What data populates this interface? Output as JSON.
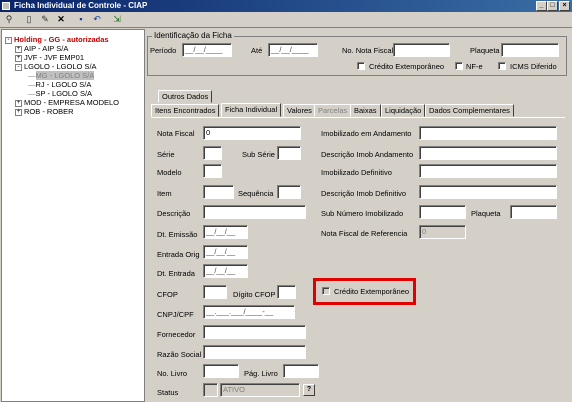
{
  "window": {
    "title": "Ficha Individual de Controle - CIAP",
    "min": "_",
    "max": "□",
    "close": "×"
  },
  "toolbar": {
    "icons": [
      "binoculars-icon",
      "new-doc-icon",
      "edit-icon",
      "delete-icon",
      "save-icon",
      "undo-icon",
      "exit-icon"
    ]
  },
  "tree": {
    "root": "Holding - GG - autorizadas",
    "items": [
      {
        "label": "AIP - AIP S/A",
        "pm": "+"
      },
      {
        "label": "JVF - JVF EMP01",
        "pm": "+"
      },
      {
        "label": "LGOLO - LGOLO S/A",
        "pm": "-"
      },
      {
        "label": "MG - LGOLO S/A",
        "sel": true
      },
      {
        "label": "RJ - LGOLO S/A"
      },
      {
        "label": "SP - LGOLO S/A"
      },
      {
        "label": "MOD - EMPRESA MODELO",
        "pm": "+"
      },
      {
        "label": "ROB - ROBER",
        "pm": "+"
      }
    ]
  },
  "ident": {
    "legend": "Identificação da Ficha",
    "periodo_label": "Período",
    "periodo_value": "__/__/____",
    "ate_label": "Até",
    "ate_value": "__/__/____",
    "nota_fiscal_label": "No. Nota Fiscal",
    "plaqueta_label": "Plaqueta",
    "cred_extemp": "Crédito Extemporâneo",
    "nfe": "NF-e",
    "icms_dif": "ICMS Diferido"
  },
  "tabs": {
    "outros": "Outros Dados",
    "list": [
      "Itens Encontrados",
      "Ficha Individual",
      "Valores",
      "Parcelas",
      "Baixas",
      "Liquidação",
      "Dados Complementares"
    ]
  },
  "form": {
    "nota_fiscal": "Nota Fiscal",
    "nota_fiscal_value": "0",
    "serie": "Série",
    "sub_serie": "Sub Série",
    "modelo": "Modelo",
    "item": "Item",
    "sequencia": "Sequência",
    "descricao": "Descrição",
    "dt_emissao": "Dt. Emissão",
    "dt_emissao_value": "__/__/__",
    "entrada_orig": "Entrada Orig",
    "entrada_orig_value": "__/__/__",
    "dt_entrada": "Dt. Entrada",
    "dt_entrada_value": "__/__/__",
    "cfop": "CFOP",
    "digito_cfop": "Dígito CFOP",
    "cnpj": "CNPJ/CPF",
    "cnpj_value": "__.___.___/____-__",
    "fornecedor": "Fornecedor",
    "razao_social": "Razão Social",
    "no_livro": "No. Livro",
    "pag_livro": "Pág. Livro",
    "status": "Status",
    "status_value": "ATIVO",
    "imob_andamento": "Imobilizado em Andamento",
    "desc_imob_andamento": "Descrição Imob Andamento",
    "imob_definitivo": "Imobilizado Definitivo",
    "desc_imob_definitivo": "Descrição Imob Definitivo",
    "sub_numero": "Sub Número Imobilizado",
    "plaqueta": "Plaqueta",
    "nf_referencia": "Nota Fiscal de Referencia",
    "nf_referencia_value": "0",
    "cred_extemp": "Crédito Extemporâneo",
    "help": "?"
  }
}
